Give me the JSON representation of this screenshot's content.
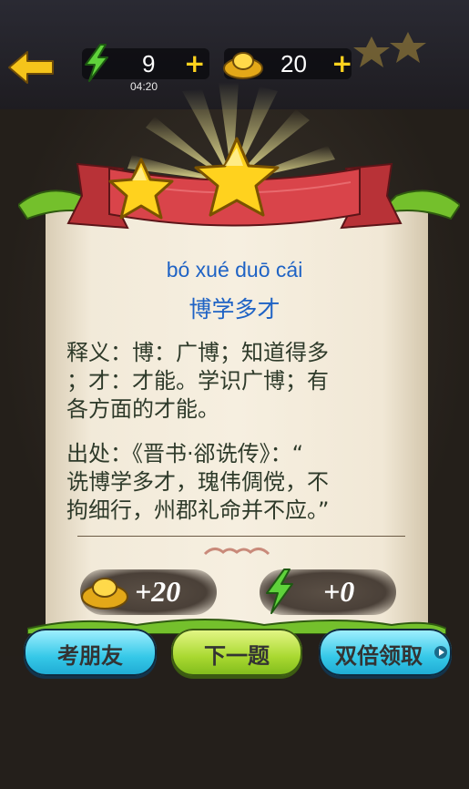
{
  "header": {
    "energy_count": "9",
    "energy_timer": "04:20",
    "gold_count": "20",
    "plus_symbol": "+"
  },
  "result": {
    "stars_earned": 2,
    "pinyin": "bó xué duō cái",
    "idiom": "博学多才",
    "meaning_lines": [
      "释义：博：广博；知道得多",
      "；才：才能。学识广博；有",
      "各方面的才能。"
    ],
    "source_lines": [
      "出处：《晋书·郤诜传》：“",
      "诜博学多才，瑰伟倜傥，不",
      "拘细行，州郡礼命并不应。”"
    ]
  },
  "rewards": {
    "gold": "+20",
    "energy": "+0"
  },
  "buttons": {
    "ask_friend": "考朋友",
    "next": "下一题",
    "double": "双倍领取"
  },
  "colors": {
    "accent_blue": "#1f63c5",
    "button_blue": "#35c8e8",
    "button_green": "#a9d830",
    "ribbon_red": "#d9444a",
    "star_gold": "#ffd21e"
  }
}
